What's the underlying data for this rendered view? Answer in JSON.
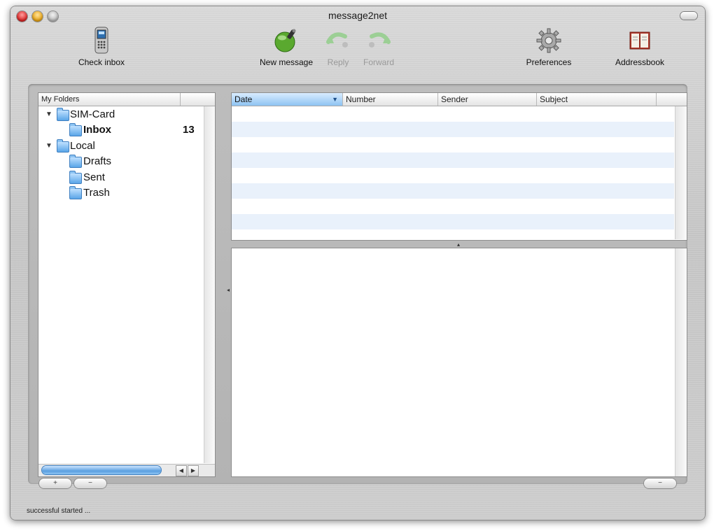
{
  "window": {
    "title": "message2net"
  },
  "toolbar": {
    "check_inbox": "Check inbox",
    "new_message": "New message",
    "reply": "Reply",
    "forward": "Forward",
    "preferences": "Preferences",
    "addressbook": "Addressbook"
  },
  "folders": {
    "header": "My Folders",
    "items": [
      {
        "label": "SIM-Card",
        "expanded": true
      },
      {
        "label": "Inbox",
        "count": "13"
      },
      {
        "label": "Local",
        "expanded": true
      },
      {
        "label": "Drafts"
      },
      {
        "label": "Sent"
      },
      {
        "label": "Trash"
      }
    ]
  },
  "message_list": {
    "columns": [
      "Date",
      "Number",
      "Sender",
      "Subject"
    ],
    "sorted_column": "Date"
  },
  "bottom_buttons": {
    "add": "+",
    "remove": "−",
    "right": "−"
  },
  "status": "successful started ..."
}
